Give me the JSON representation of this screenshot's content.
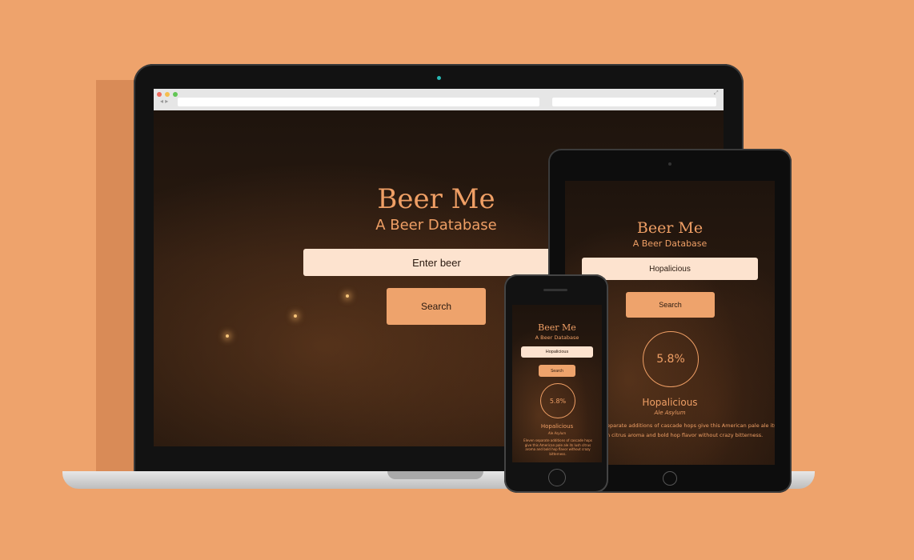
{
  "colors": {
    "background": "#eea36c",
    "accent": "#ef9f65",
    "input_bg": "#fde3cf"
  },
  "laptop": {
    "app_title": "Beer Me",
    "subtitle": "A Beer Database",
    "search": {
      "value": "Enter beer"
    },
    "search_button": "Search"
  },
  "tablet": {
    "app_title": "Beer Me",
    "subtitle": "A Beer Database",
    "search": {
      "value": "Hopalicious"
    },
    "search_button": "Search",
    "abv": "5.8%",
    "beer_name": "Hopalicious",
    "brewery": "Ale Asylum",
    "description_line1": "eparate additions of cascade hops give this American pale ale its",
    "description_line2": "n citrus aroma and bold hop flavor without crazy bitterness."
  },
  "phone": {
    "app_title": "Beer Me",
    "subtitle": "A Beer Database",
    "search": {
      "value": "Hopalicious"
    },
    "search_button": "Search",
    "abv": "5.8%",
    "beer_name": "Hopalicious",
    "brewery": "Ale Asylum",
    "description": "Eleven separate additions of cascade hops give this American pale ale its lush citrus aroma and bold hop flavor without crazy bitterness."
  }
}
